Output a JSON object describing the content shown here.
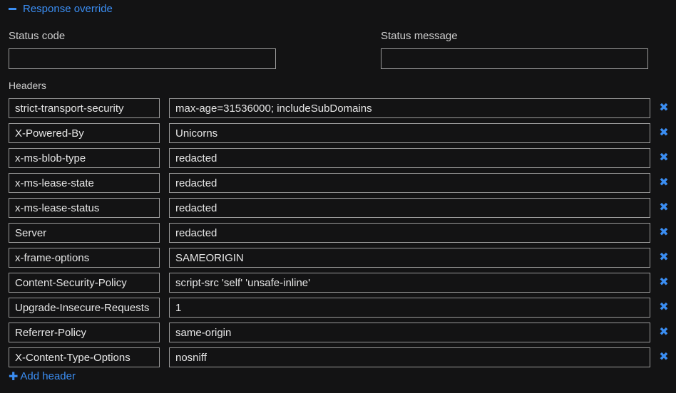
{
  "section": {
    "toggle_label": "Response override",
    "toggle_icon": "minus-icon"
  },
  "status_code": {
    "label": "Status code",
    "value": ""
  },
  "status_message": {
    "label": "Status message",
    "value": ""
  },
  "headers": {
    "label": "Headers",
    "remove_icon": "close-icon",
    "rows": [
      {
        "name": "strict-transport-security",
        "value": "max-age=31536000; includeSubDomains"
      },
      {
        "name": "X-Powered-By",
        "value": "Unicorns"
      },
      {
        "name": "x-ms-blob-type",
        "value": "redacted"
      },
      {
        "name": "x-ms-lease-state",
        "value": "redacted"
      },
      {
        "name": "x-ms-lease-status",
        "value": "redacted"
      },
      {
        "name": "Server",
        "value": "redacted"
      },
      {
        "name": "x-frame-options",
        "value": "SAMEORIGIN"
      },
      {
        "name": "Content-Security-Policy",
        "value": "script-src 'self' 'unsafe-inline'"
      },
      {
        "name": "Upgrade-Insecure-Requests",
        "value": "1"
      },
      {
        "name": "Referrer-Policy",
        "value": "same-origin"
      },
      {
        "name": "X-Content-Type-Options",
        "value": "nosniff"
      }
    ],
    "add_label": "Add header",
    "add_icon": "plus-icon"
  },
  "colors": {
    "background": "#131314",
    "accent": "#3b8ef3",
    "border": "#9a9a9a",
    "text": "#dcdcdc"
  }
}
